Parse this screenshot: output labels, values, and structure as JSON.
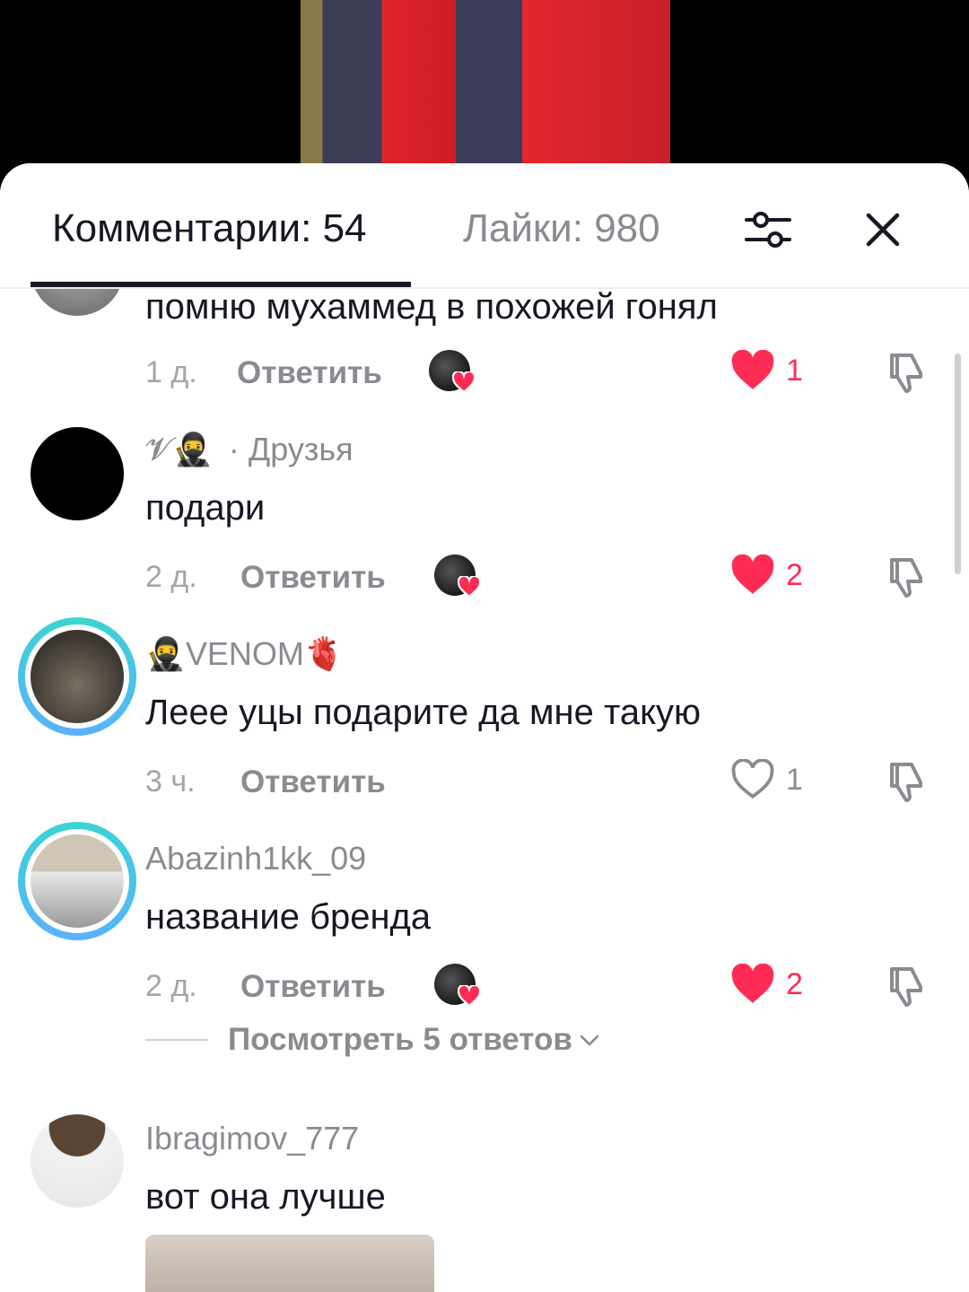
{
  "header": {
    "comments_tab": "Комментарии: 54",
    "likes_tab": "Лайки: 980",
    "filter_icon": "sliders-icon",
    "close_icon": "close-icon"
  },
  "comments": [
    {
      "username": "",
      "text": "помню мухаммед в похожей гонял",
      "time": "1 д.",
      "reply": "Ответить",
      "likes": "1",
      "liked": true,
      "creator_liked": true
    },
    {
      "username": "𝓥🥷",
      "tag": "· Друзья",
      "text": "подари",
      "time": "2 д.",
      "reply": "Ответить",
      "likes": "2",
      "liked": true,
      "creator_liked": true
    },
    {
      "username": "🥷VENOM🫀",
      "text": "Лeee уцы подарите да мне такую",
      "time": "3 ч.",
      "reply": "Ответить",
      "likes": "1",
      "liked": false,
      "creator_liked": false
    },
    {
      "username": "Abazinh1kk_09",
      "text": "название бренда",
      "time": "2 д.",
      "reply": "Ответить",
      "likes": "2",
      "liked": true,
      "creator_liked": true,
      "view_replies": "Посмотреть 5 ответов"
    },
    {
      "username": "Ibragimov_777",
      "text": "вот она лучше"
    }
  ],
  "colors": {
    "like_red": "#fe2c55",
    "text_primary": "#161823",
    "text_secondary": "#8a8b91",
    "story_ring": "#3ad6d0"
  }
}
